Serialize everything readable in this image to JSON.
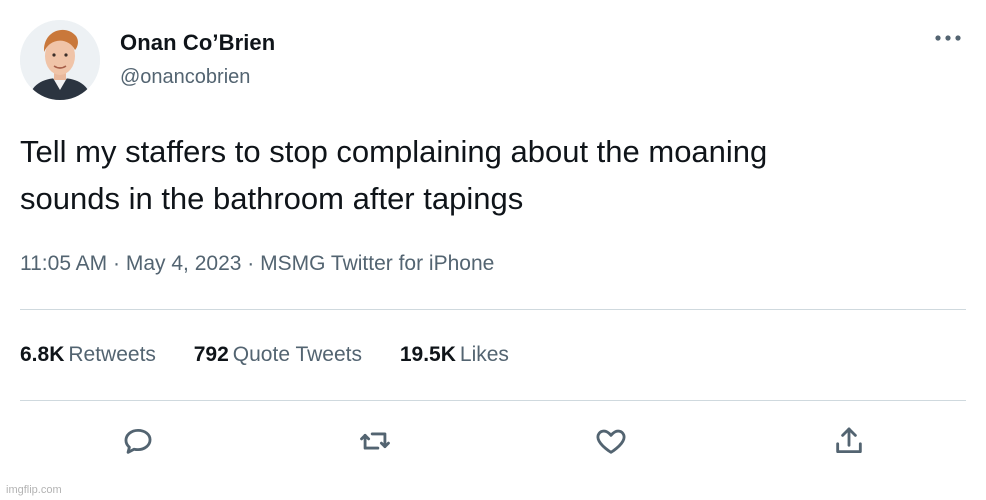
{
  "tweet": {
    "author": {
      "display_name": "Onan Co’Brien",
      "handle": "@onancobrien",
      "avatar_icon": "user-avatar-photo"
    },
    "text_line1": "Tell my staffers to stop complaining about the moaning",
    "text_line2": "sounds in the bathroom after tapings",
    "time": "11:05 AM",
    "separator": "·",
    "date": "May 4, 2023",
    "source": "MSMG Twitter for iPhone",
    "stats": {
      "retweets_count": "6.8K",
      "retweets_label": "Retweets",
      "quotes_count": "792",
      "quotes_label": "Quote Tweets",
      "likes_count": "19.5K",
      "likes_label": "Likes"
    },
    "actions": [
      "reply-icon",
      "retweet-icon",
      "like-icon",
      "share-icon"
    ]
  },
  "watermark": "imgflip.com",
  "colors": {
    "text_primary": "#0f1419",
    "text_secondary": "#536471",
    "divider": "#cfd9de",
    "background": "#ffffff"
  }
}
